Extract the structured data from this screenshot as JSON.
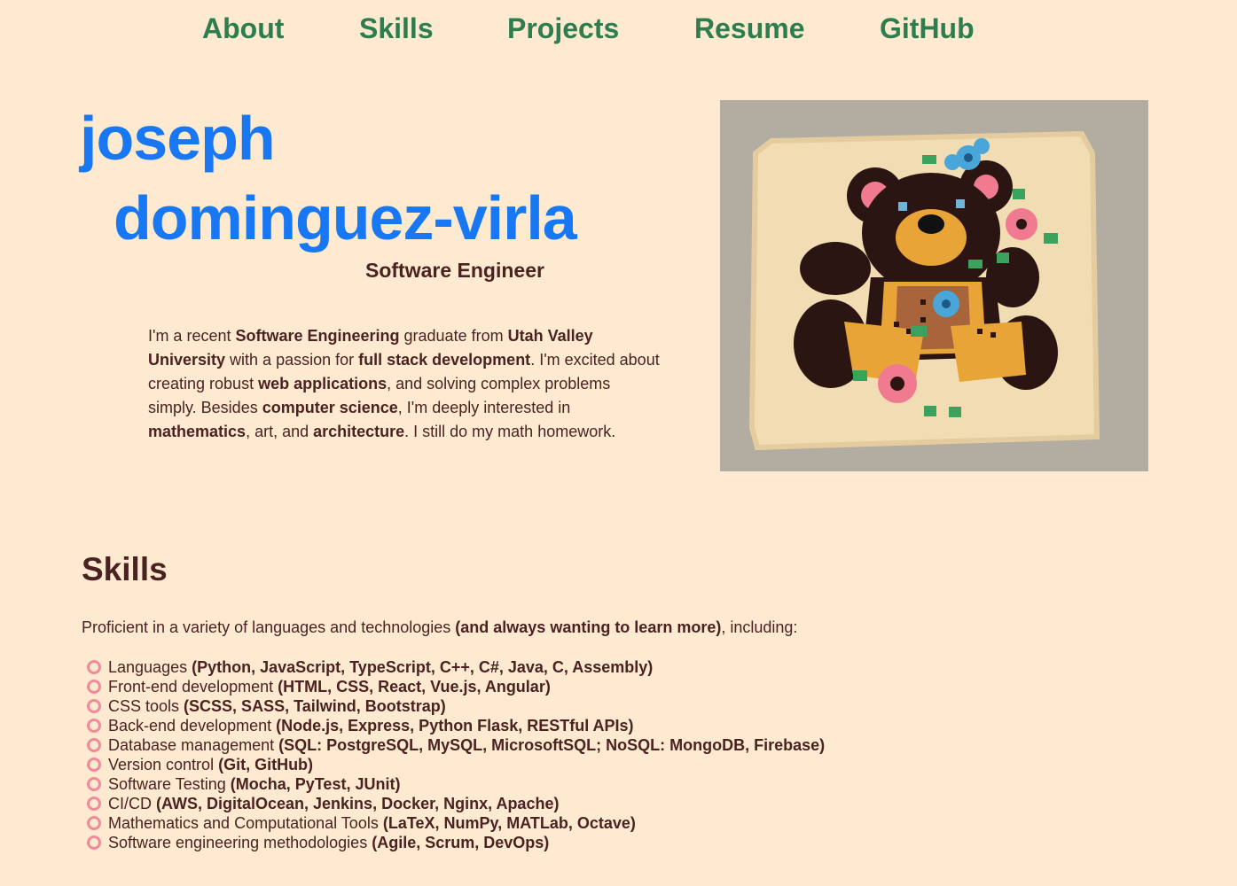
{
  "nav": {
    "items": [
      {
        "label": "About"
      },
      {
        "label": "Skills"
      },
      {
        "label": "Projects"
      },
      {
        "label": "Resume"
      },
      {
        "label": "GitHub"
      }
    ]
  },
  "hero": {
    "name_line_1": "joseph",
    "name_line_2": "dominguez-virla",
    "subtitle": "Software Engineer",
    "intro": {
      "s1": "I'm a recent ",
      "b1": "Software Engineering",
      "s2": " graduate from ",
      "b2": "Utah Valley University",
      "s3": " with a passion for ",
      "b3": "full stack development",
      "s4": ". I'm excited about creating robust ",
      "b4": "web applications",
      "s5": ", and solving complex problems simply. Besides ",
      "b5": "computer science",
      "s6": ", I'm deeply interested in ",
      "b6": "mathematics",
      "s7": ", art, and ",
      "b7": "architecture",
      "s8": ". I still do my math homework."
    },
    "image_subject": "teddy-bear-latch-hook-rug"
  },
  "skills": {
    "title": "Skills",
    "intro_pre": "Proficient in a variety of languages and technologies ",
    "intro_bold": "(and always wanting to learn more)",
    "intro_post": ", including:",
    "items": [
      {
        "category": "Languages",
        "tools": "(Python, JavaScript, TypeScript, C++, C#, Java, C, Assembly)"
      },
      {
        "category": "Front-end development",
        "tools": "(HTML, CSS, React, Vue.js, Angular)"
      },
      {
        "category": "CSS tools",
        "tools": "(SCSS, SASS, Tailwind, Bootstrap)"
      },
      {
        "category": "Back-end development",
        "tools": "(Node.js, Express, Python Flask, RESTful APIs)"
      },
      {
        "category": "Database management",
        "tools": "(SQL: PostgreSQL, MySQL, MicrosoftSQL; NoSQL: MongoDB, Firebase)"
      },
      {
        "category": "Version control",
        "tools": "(Git, GitHub)"
      },
      {
        "category": "Software Testing",
        "tools": "(Mocha, PyTest, JUnit)"
      },
      {
        "category": "CI/CD",
        "tools": "(AWS, DigitalOcean, Jenkins, Docker, Nginx, Apache)"
      },
      {
        "category": "Mathematics and Computational Tools",
        "tools": "(LaTeX, NumPy, MATLab, Octave)"
      },
      {
        "category": "Software engineering methodologies",
        "tools": "(Agile, Scrum, DevOps)"
      }
    ]
  },
  "colors": {
    "background": "#feead0",
    "nav_link": "#2e7d4f",
    "name": "#1877f2",
    "text": "#4a2222",
    "bullet": "#f28a9a"
  }
}
